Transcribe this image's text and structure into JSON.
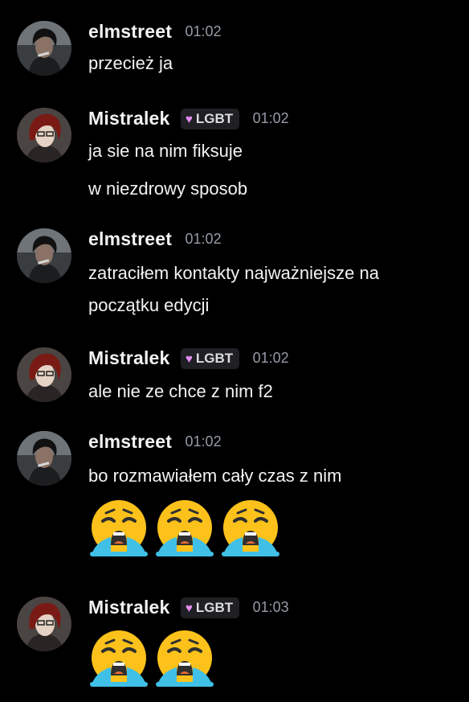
{
  "messages": [
    {
      "user": "elmstreet",
      "time": "01:02",
      "lines": [
        "przecież ja"
      ],
      "emojis": []
    },
    {
      "user": "Mistralek",
      "tag": "LGBT",
      "time": "01:02",
      "lines": [
        "ja sie na nim fiksuje",
        "w niezdrowy sposob"
      ],
      "emojis": []
    },
    {
      "user": "elmstreet",
      "time": "01:02",
      "lines": [
        "zatraciłem kontakty najważniejsze na",
        "początku edycji"
      ],
      "emojis": []
    },
    {
      "user": "Mistralek",
      "tag": "LGBT",
      "time": "01:02",
      "lines": [
        "ale nie ze chce z nim f2"
      ],
      "emojis": []
    },
    {
      "user": "elmstreet",
      "time": "01:02",
      "lines": [
        "bo rozmawiałem cały czas z nim"
      ],
      "emojis": [
        "loudly-crying-face",
        "loudly-crying-face",
        "loudly-crying-face"
      ]
    },
    {
      "user": "Mistralek",
      "tag": "LGBT",
      "time": "01:03",
      "lines": [],
      "emojis": [
        "loudly-crying-face",
        "loudly-crying-face"
      ]
    }
  ],
  "colors": {
    "background": "#000000",
    "username": "#f2f3f5",
    "timestamp": "#949ba4",
    "tag_background": "#1f1f24",
    "tag_heart": "#e58cf0"
  },
  "icons": {
    "tag_icon": "purple-heart-icon",
    "elmstreet_avatar": "avatar-dark-hair-man",
    "mistralek_avatar": "avatar-red-hair-anime"
  }
}
